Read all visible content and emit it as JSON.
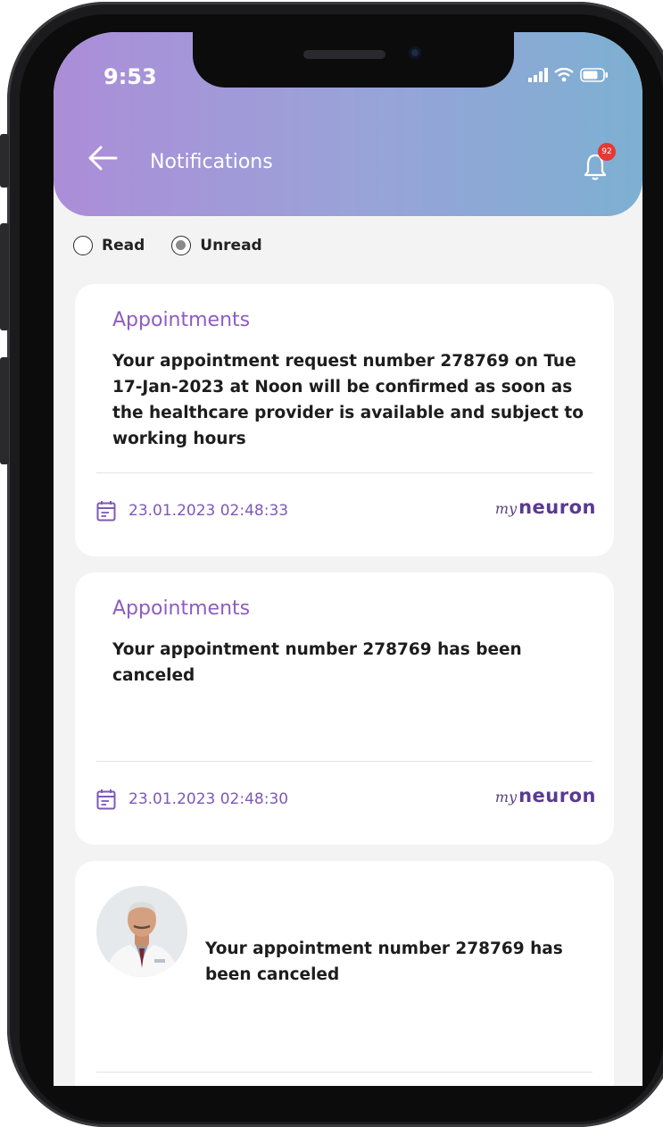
{
  "status_bar": {
    "time": "9:53"
  },
  "header": {
    "title": "Notifications",
    "badge_count": "92"
  },
  "filters": {
    "read_label": "Read",
    "unread_label": "Unread",
    "selected": "Unread"
  },
  "notifications": [
    {
      "title": "Appointments",
      "message": "Your appointment request number 278769 on Tue 17-Jan-2023 at Noon will be confirmed as soon as the healthcare provider is available and subject to working hours",
      "timestamp": "23.01.2023 02:48:33",
      "brand": "myneuron"
    },
    {
      "title": "Appointments",
      "message": "Your appointment number 278769 has been canceled",
      "timestamp": "23.01.2023 02:48:30",
      "brand": "myneuron"
    },
    {
      "title": "",
      "message": "Your appointment number 278769 has been canceled",
      "has_avatar": true
    }
  ],
  "brand": {
    "my": "my",
    "neuron": "neuron"
  },
  "colors": {
    "accent": "#8e5cc2",
    "header_start": "#ac8dd8",
    "header_end": "#7db0d2",
    "badge": "#e53935"
  }
}
